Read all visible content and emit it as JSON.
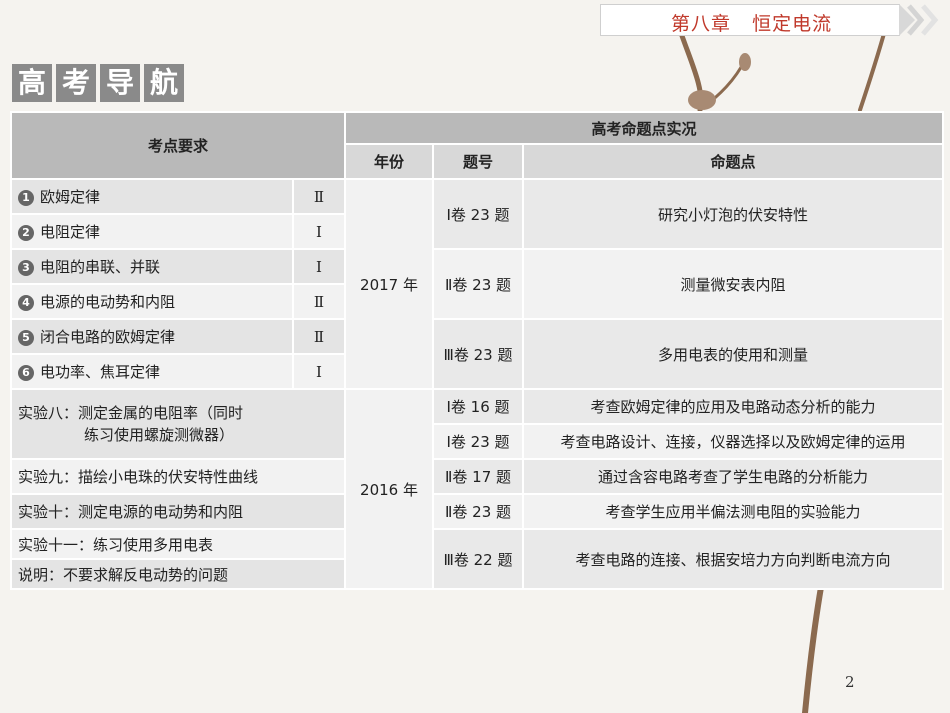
{
  "header": {
    "chapter": "第八章   恒定电流"
  },
  "title_chars": [
    "高",
    "考",
    "导",
    "航"
  ],
  "table": {
    "col_requirements": "考点要求",
    "col_exam_group": "高考命题点实况",
    "col_year": "年份",
    "col_question": "题号",
    "col_point": "命题点",
    "requirements": [
      {
        "num": "1",
        "text": "欧姆定律",
        "level": "Ⅱ"
      },
      {
        "num": "2",
        "text": "电阻定律",
        "level": "Ⅰ"
      },
      {
        "num": "3",
        "text": "电阻的串联、并联",
        "level": "Ⅰ"
      },
      {
        "num": "4",
        "text": "电源的电动势和内阻",
        "level": "Ⅱ"
      },
      {
        "num": "5",
        "text": "闭合电路的欧姆定律",
        "level": "Ⅱ"
      },
      {
        "num": "6",
        "text": "电功率、焦耳定律",
        "level": "Ⅰ"
      }
    ],
    "experiments": [
      {
        "line1": "实验八：测定金属的电阻率（同时",
        "line2": "练习使用螺旋测微器）"
      },
      {
        "line1": "实验九：描绘小电珠的伏安特性曲线"
      },
      {
        "line1": "实验十：测定电源的电动势和内阻"
      },
      {
        "line1": "实验十一：练习使用多用电表"
      },
      {
        "line1": "说明：不要求解反电动势的问题"
      }
    ],
    "year_2017": "2017 年",
    "year_2016": "2016 年",
    "rows_2017": [
      {
        "question": "Ⅰ卷 23 题",
        "point": "研究小灯泡的伏安特性"
      },
      {
        "question": "Ⅱ卷 23 题",
        "point": "测量微安表内阻"
      },
      {
        "question": "Ⅲ卷 23 题",
        "point": "多用电表的使用和测量"
      }
    ],
    "rows_2016": [
      {
        "question": "Ⅰ卷 16 题",
        "point": "考查欧姆定律的应用及电路动态分析的能力"
      },
      {
        "question": "Ⅰ卷 23 题",
        "point": "考查电路设计、连接，仪器选择以及欧姆定律的运用"
      },
      {
        "question": "Ⅱ卷 17 题",
        "point": "通过含容电路考查了学生电路的分析能力"
      },
      {
        "question": "Ⅱ卷 23 题",
        "point": "考查学生应用半偏法测电阻的实验能力"
      },
      {
        "question": "Ⅲ卷 22 题",
        "point": "考查电路的连接、根据安培力方向判断电流方向"
      }
    ]
  },
  "page_number": "2",
  "colors": {
    "accent": "#c0392b",
    "tile": "#8a8a8a",
    "header": "#b9b9b9"
  },
  "icons": {
    "decor": "branch-decoration",
    "banner": "chevron-right-icon"
  }
}
